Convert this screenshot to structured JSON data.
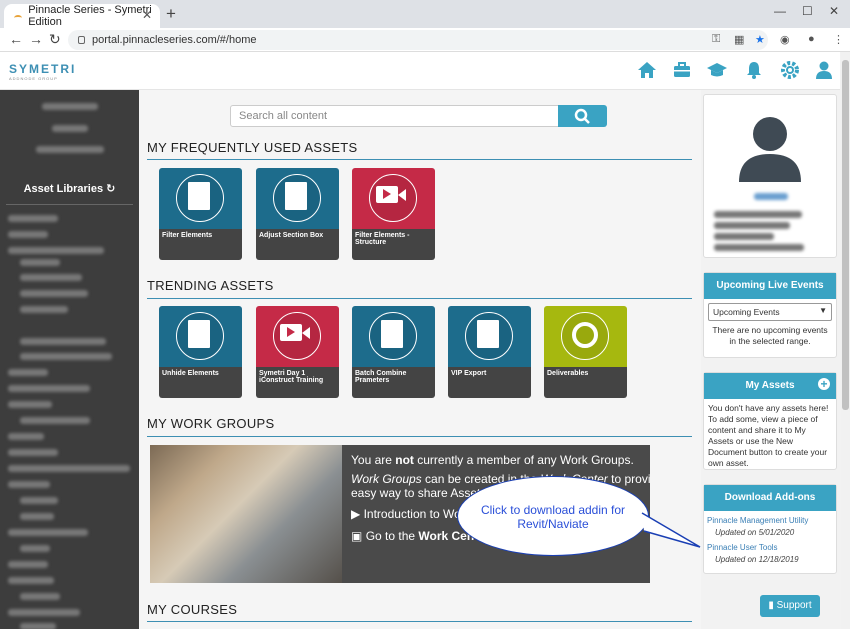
{
  "browser": {
    "tab_title": "Pinnacle Series - Symetri Edition",
    "url": "portal.pinnacleseries.com/#/home",
    "new_tab": "+",
    "close_tab": "✕"
  },
  "header": {
    "logo": "SYMETRI",
    "logo_sub": "ADDNODE GROUP"
  },
  "sidebar": {
    "title": "Asset Libraries"
  },
  "search": {
    "placeholder": "Search all content"
  },
  "sections": {
    "frequent": "MY FREQUENTLY USED ASSETS",
    "trending": "TRENDING ASSETS",
    "workgroups": "MY WORK GROUPS",
    "courses": "MY COURSES"
  },
  "frequent_tiles": [
    {
      "label": "Filter Elements",
      "color": "#1d6c8c",
      "icon": "document-icon"
    },
    {
      "label": "Adjust Section Box",
      "color": "#1d6c8c",
      "icon": "document-icon"
    },
    {
      "label": "Filter Elements - Structure",
      "color": "#c52a47",
      "icon": "video-icon"
    }
  ],
  "trending_tiles": [
    {
      "label": "Unhide Elements",
      "color": "#1d6c8c",
      "icon": "document-icon"
    },
    {
      "label": "Symetri Day 1 iConstruct Training",
      "color": "#c52a47",
      "icon": "video-icon"
    },
    {
      "label": "Batch Combine Prameters",
      "color": "#1d6c8c",
      "icon": "document-icon"
    },
    {
      "label": "VIP Export",
      "color": "#1d6c8c",
      "icon": "document-icon"
    },
    {
      "label": "Deliverables",
      "color": "#a6b80f",
      "icon": "gear-icon"
    }
  ],
  "workgroups": {
    "line1_pre": "You are ",
    "line1_bold": "not",
    "line1_post": " currently a member of any Work Groups.",
    "line2_italic": "Work Groups",
    "line2_post": " can be created in the",
    "line2_italic2": "Work Center",
    "line2_end": "to provide an",
    "line3": "easy way to share Assets",
    "link1": "Introduction to Wor",
    "link2_pre": "Go to the ",
    "link2_bold": "Work Cen"
  },
  "callout": {
    "text": "Click to download addin for Revit/Naviate"
  },
  "upcoming": {
    "title": "Upcoming Live Events",
    "select_value": "Upcoming Events",
    "empty": "There are no upcoming events in the selected range."
  },
  "my_assets": {
    "title": "My Assets",
    "text": "You don't have any assets here! To add some, view a piece of content and share it to My Assets or use the New Document button to create your own asset."
  },
  "addons": {
    "title": "Download Add-ons",
    "items": [
      {
        "name": "Pinnacle Management Utility",
        "updated": "Updated on 5/01/2020"
      },
      {
        "name": "Pinnacle User Tools",
        "updated": "Updated on 12/18/2019"
      }
    ]
  },
  "support": {
    "label": "Support"
  }
}
